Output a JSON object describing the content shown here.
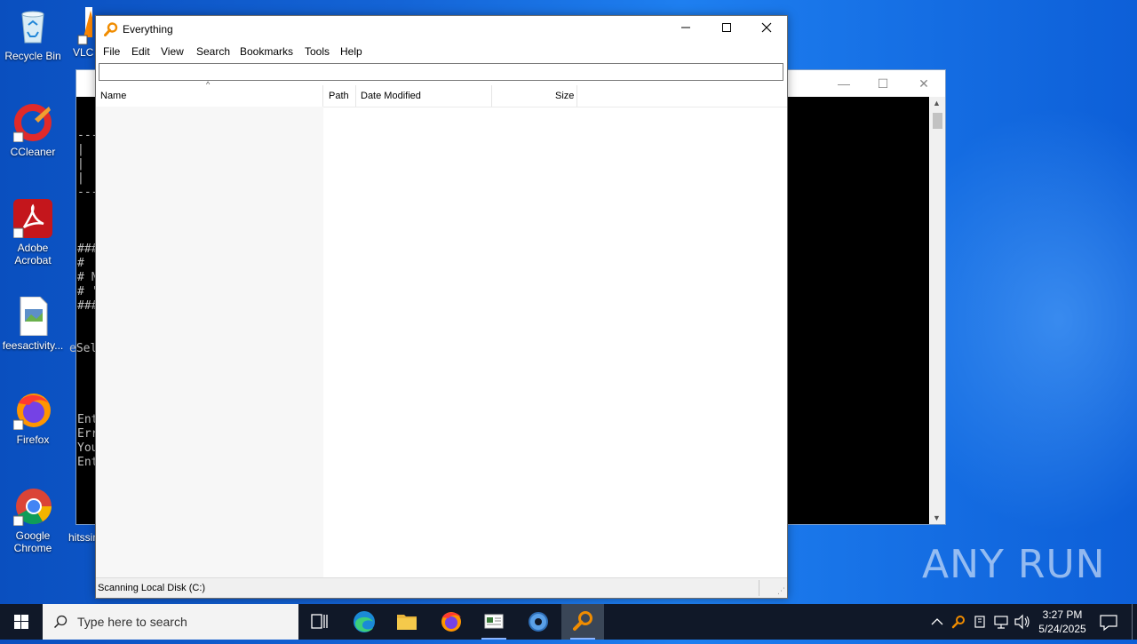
{
  "desktop": {
    "icons": [
      {
        "label": "Recycle Bin"
      },
      {
        "label": "VLC"
      },
      {
        "label": "CCleaner"
      },
      {
        "label": "Adobe Acrobat"
      },
      {
        "label": "feesactivity..."
      },
      {
        "label": "Firefox"
      },
      {
        "label": "Google Chrome"
      },
      {
        "label": "hitssin"
      }
    ],
    "watermark": "ANY RUN"
  },
  "console": {
    "lines": [
      "---",
      "|",
      "|",
      "|",
      "---",
      "###",
      "#",
      "# N",
      "# '",
      "###",
      "eSel",
      "Ent",
      "Err",
      "You",
      "Ent"
    ]
  },
  "everything": {
    "title": "Everything",
    "menu": [
      "File",
      "Edit",
      "View",
      "Search",
      "Bookmarks",
      "Tools",
      "Help"
    ],
    "search_value": "",
    "columns": {
      "name": "Name",
      "path": "Path",
      "date_modified": "Date Modified",
      "size": "Size"
    },
    "status": "Scanning Local Disk (C:)"
  },
  "taskbar": {
    "search_placeholder": "Type here to search",
    "time": "3:27 PM",
    "date": "5/24/2025"
  },
  "colors": {
    "desktop_blue": "#1464d6",
    "taskbar": "#101828",
    "everything_icon": "#f08c00"
  }
}
